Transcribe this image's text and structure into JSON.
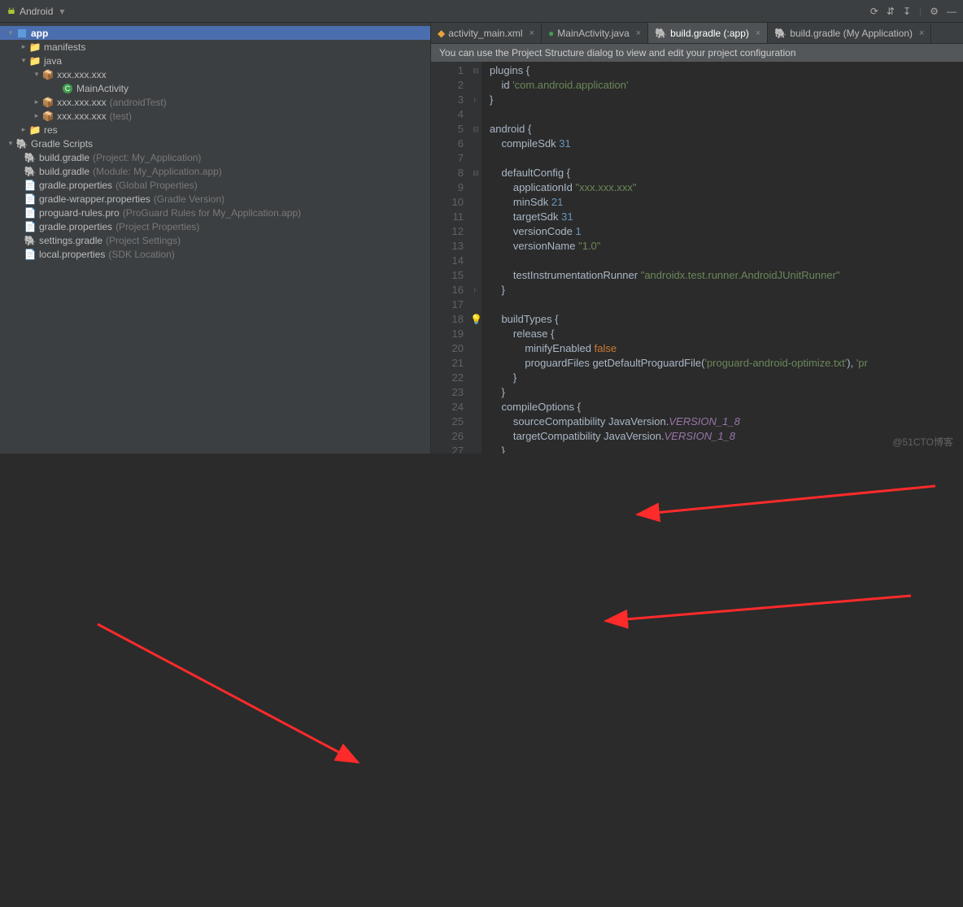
{
  "toolbar": {
    "navLabel": "Android",
    "icons": {
      "history": "⟳",
      "sync": "⇵",
      "sort": "↧",
      "settings": "⚙",
      "hide": "—"
    }
  },
  "tree": {
    "app": "app",
    "manifests": "manifests",
    "java": "java",
    "pkg1": "xxx.xxx.xxx",
    "mainActivity": "MainActivity",
    "pkg2": "xxx.xxx.xxx",
    "pkg2hint": "(androidTest)",
    "pkg3": "xxx.xxx.xxx",
    "pkg3hint": "(test)",
    "res": "res",
    "gradleScripts": "Gradle Scripts",
    "bg1": "build.gradle",
    "bg1hint": "(Project: My_Application)",
    "bg2": "build.gradle",
    "bg2hint": "(Module: My_Application.app)",
    "gp1": "gradle.properties",
    "gp1hint": "(Global Properties)",
    "gwp": "gradle-wrapper.properties",
    "gwphint": "(Gradle Version)",
    "pgr": "proguard-rules.pro",
    "pgrhint": "(ProGuard Rules for My_Application.app)",
    "gp2": "gradle.properties",
    "gp2hint": "(Project Properties)",
    "sg": "settings.gradle",
    "sghint": "(Project Settings)",
    "lp": "local.properties",
    "lphint": "(SDK Location)"
  },
  "tabs": {
    "t1": "activity_main.xml",
    "t2": "MainActivity.java",
    "t3": "build.gradle (:app)",
    "t4": "build.gradle (My Application)",
    "close": "×"
  },
  "banner": "You can use the Project Structure dialog to view and edit your project configuration",
  "code": {
    "l1_a": "plugins {",
    "l2_a": "    id ",
    "l2_b": "'com.android.application'",
    "l3": "}",
    "l5_a": "android {",
    "l6_a": "    compileSdk ",
    "l6_b": "31",
    "l8_a": "    defaultConfig {",
    "l9_a": "        applicationId ",
    "l9_b": "\"xxx.xxx.xxx\"",
    "l10_a": "        minSdk ",
    "l10_b": "21",
    "l11_a": "        targetSdk ",
    "l11_b": "31",
    "l12_a": "        versionCode ",
    "l12_b": "1",
    "l13_a": "        versionName ",
    "l13_b": "\"1.0\"",
    "l15_a": "        testInstrumentationRunner ",
    "l15_b": "\"androidx.test.runner.AndroidJUnitRunner\"",
    "l16": "    }",
    "l18_a": "    buildTypes {",
    "l19_a": "        release {",
    "l20_a": "            minifyEnabled ",
    "l20_b": "false",
    "l21_a": "            proguardFiles getDefaultProguardFile(",
    "l21_b": "'proguard-android-optimize.txt'",
    "l21_c": "), ",
    "l21_d": "'pr",
    "l22": "        }",
    "l23": "    }",
    "l24_a": "    compileOptions {",
    "l25_a": "        sourceCompatibility JavaVersion.",
    "l25_b": "VERSION_1_8",
    "l26_a": "        targetCompatibility JavaVersion.",
    "l26_b": "VERSION_1_8",
    "l27": "    }"
  },
  "lineNumbers": [
    "1",
    "2",
    "3",
    "4",
    "5",
    "6",
    "7",
    "8",
    "9",
    "10",
    "11",
    "12",
    "13",
    "14",
    "15",
    "16",
    "17",
    "18",
    "19",
    "20",
    "21",
    "22",
    "23",
    "24",
    "25",
    "26",
    "27"
  ],
  "watermark": "@51CTO博客"
}
